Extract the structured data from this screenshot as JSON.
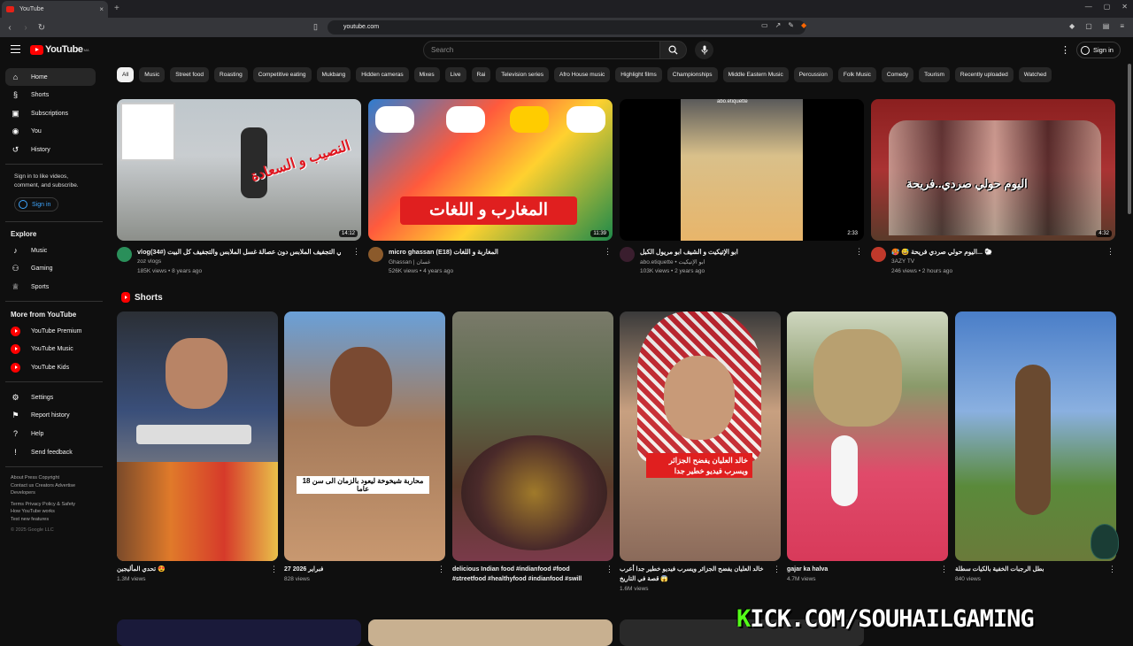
{
  "browser": {
    "tab_title": "YouTube",
    "tab_close": "×",
    "new_tab": "+",
    "url": "youtube.com"
  },
  "masthead": {
    "logo_text": "YouTube",
    "logo_badge": "MA",
    "search_placeholder": "Search",
    "signin_label": "Sign in"
  },
  "sidebar": {
    "main": [
      {
        "label": "Home",
        "icon": "home-icon",
        "glyph": "⌂"
      },
      {
        "label": "Shorts",
        "icon": "shorts-icon",
        "glyph": "§"
      },
      {
        "label": "Subscriptions",
        "icon": "subscriptions-icon",
        "glyph": "▣"
      },
      {
        "label": "You",
        "icon": "you-icon",
        "glyph": "◉"
      },
      {
        "label": "History",
        "icon": "history-icon",
        "glyph": "↺"
      }
    ],
    "signin_text": "Sign in to like videos, comment, and subscribe.",
    "signin_button": "Sign in",
    "explore_heading": "Explore",
    "explore": [
      {
        "label": "Music",
        "icon": "music-icon",
        "glyph": "♪"
      },
      {
        "label": "Gaming",
        "icon": "gaming-icon",
        "glyph": "⚇"
      },
      {
        "label": "Sports",
        "icon": "sports-icon",
        "glyph": "♕"
      }
    ],
    "more_heading": "More from YouTube",
    "more": [
      {
        "label": "YouTube Premium",
        "icon": "youtube-premium-icon"
      },
      {
        "label": "YouTube Music",
        "icon": "youtube-music-icon"
      },
      {
        "label": "YouTube Kids",
        "icon": "youtube-kids-icon"
      }
    ],
    "settings": [
      {
        "label": "Settings",
        "icon": "settings-icon",
        "glyph": "⚙"
      },
      {
        "label": "Report history",
        "icon": "report-flag-icon",
        "glyph": "⚑"
      },
      {
        "label": "Help",
        "icon": "help-icon",
        "glyph": "?"
      },
      {
        "label": "Send feedback",
        "icon": "feedback-icon",
        "glyph": "!"
      }
    ],
    "footer_line1": "About  Press  Copyright",
    "footer_line2": "Contact us  Creators  Advertise",
    "footer_line3": "Developers",
    "footer_line4": "Terms  Privacy  Policy & Safety",
    "footer_line5": "How YouTube works",
    "footer_line6": "Test new features",
    "footer_copy": "© 2025 Google LLC"
  },
  "chips": [
    "All",
    "Music",
    "Street food",
    "Roasting",
    "Competitive eating",
    "Mukbang",
    "Hidden cameras",
    "Mixes",
    "Live",
    "Rai",
    "Television series",
    "Afro House music",
    "Highlight films",
    "Championships",
    "Middle Eastern Music",
    "Percussion",
    "Folk Music",
    "Comedy",
    "Tourism",
    "Recently uploaded",
    "Watched"
  ],
  "videos": [
    {
      "title": "vlog(34#) طريقة في التجفيف الملابس دون عصالة  غسل الملابس والتجفيف كل البيت",
      "channel": "zoz vlogs",
      "stats": "185K views • 8 years ago",
      "duration": "14:12",
      "overlay": "النصيب و السعادة",
      "avatar_color": "#2a8f5a"
    },
    {
      "title": "micro ghassan (E18) المغاربة و اللغات",
      "channel": "Ghassan | غسان",
      "stats": "526K views • 4 years ago",
      "duration": "11:39",
      "overlay": "المغارب و اللغات",
      "avatar_color": "#8b5a2b"
    },
    {
      "title": "ابو الإتيكيت و الشيف ابو مريول الكبل",
      "channel": "abo.etiquette • ابو الإتيكيت",
      "stats": "103K views • 2 years ago",
      "duration": "2:33",
      "overlay": "abo.etiquette",
      "avatar_color": "#3a1e2e"
    },
    {
      "title": "🥵 😅 اليوم حولي صردي فريحة... 🐑",
      "channel": "3AZY TV",
      "stats": "246 views • 2 hours ago",
      "duration": "4:32",
      "overlay": "اليوم حولي صردي..فريحة",
      "avatar_color": "#c0392b"
    }
  ],
  "shorts_heading": "Shorts",
  "shorts": [
    {
      "title": "تحدي المأليجين 😍",
      "views": "1.3M views",
      "caption": ""
    },
    {
      "title": "27 2026 فبراير",
      "views": "828 views",
      "caption": "محاربة شيخوخة ليعود بالزمان الى سن 18 عاما"
    },
    {
      "title": "delicious Indian food #indianfood #food #streetfood #healthyfood #indianfood #swill",
      "views": "",
      "caption": ""
    },
    {
      "title": "خالد العليان يفضح الجزائر ويسرب فيديو خطير جدا أعرب قصة في التاريخ 😱",
      "views": "1.6M views",
      "caption": "خالد العليان يفضح الجزائر ويسرب فيديو خطير جدا"
    },
    {
      "title": "gajar ka halva",
      "views": "4.7M views",
      "caption": ""
    },
    {
      "title": "بطل الرجبات الخفية بالكيات سطلة",
      "views": "840 views",
      "caption": ""
    }
  ],
  "watermark": {
    "kick_k": "K",
    "kick_rest": "ICK.COM/SOUHAILGAMING"
  }
}
